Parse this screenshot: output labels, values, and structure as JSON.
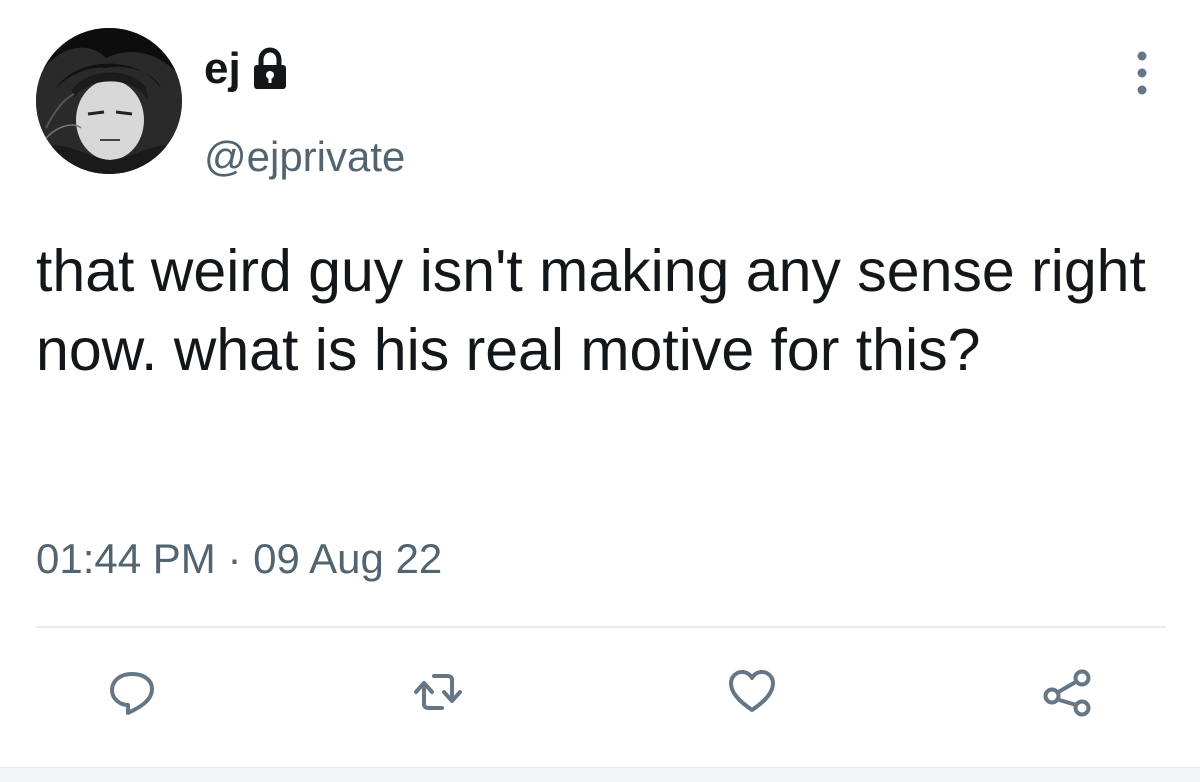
{
  "author": {
    "display_name": "ej",
    "handle": "@ejprivate",
    "protected_icon": "lock-icon",
    "avatar": "avatar-image"
  },
  "tweet": {
    "text": "that weird guy isn't making any sense right now. what is his real motive for this?",
    "timestamp": "01:44 PM · 09 Aug 22"
  },
  "menu_icon": "more-vertical-icon",
  "actions": [
    {
      "name": "reply",
      "icon": "reply-icon"
    },
    {
      "name": "retweet",
      "icon": "retweet-icon"
    },
    {
      "name": "like",
      "icon": "heart-icon"
    },
    {
      "name": "share",
      "icon": "share-icon"
    }
  ],
  "colors": {
    "text": "#14171a",
    "secondary": "#536471",
    "icon": "#657786",
    "divider": "#e6ecf0"
  }
}
